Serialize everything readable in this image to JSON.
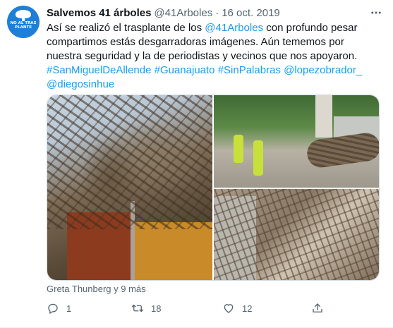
{
  "tweet": {
    "display_name": "Salvemos 41 árboles",
    "handle": "@41Arboles",
    "separator": "·",
    "date": "16 oct. 2019",
    "avatar_text": "NO AL TRAS PLANTE",
    "text": {
      "part1": "Así se realizó el trasplante de los ",
      "mention1": "@41Arboles",
      "part2": " con profundo pesar compartimos estás desgarradoras imágenes. Aún tememos por nuestra seguridad y la de periodistas y vecinos que nos apoyaron.",
      "tags": [
        "#SanMiguelDeAllende",
        "#Guanajuato",
        "#SinPalabras",
        "@lopezobrador_",
        "@diegosinhue"
      ]
    },
    "tagged_users": "Greta Thunberg y 9 más",
    "actions": {
      "reply_count": "1",
      "retweet_count": "18",
      "like_count": "12"
    }
  },
  "colors": {
    "text": "#0f1419",
    "secondary": "#536471",
    "link": "#1d9bf0",
    "avatar_bg": "#1d7fd8"
  },
  "icons": [
    "more-icon",
    "reply-icon",
    "retweet-icon",
    "like-icon",
    "share-icon"
  ]
}
